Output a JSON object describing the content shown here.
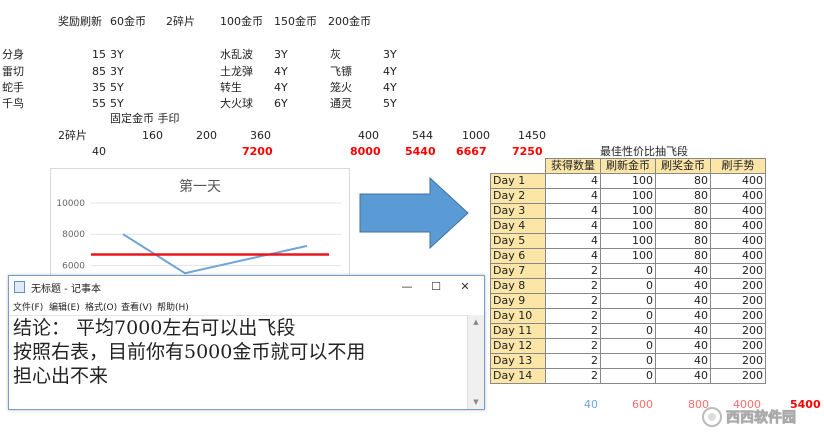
{
  "top": {
    "row1": [
      "奖励刷新",
      "60金币",
      "2碎片",
      "100金币",
      "150金币",
      "200金币"
    ],
    "items_col1": [
      {
        "name": "分身",
        "val": "15",
        "dur": "3Y"
      },
      {
        "name": "雷切",
        "val": "85",
        "dur": "3Y"
      },
      {
        "name": "蛇手",
        "val": "35",
        "dur": "5Y"
      },
      {
        "name": "千鸟",
        "val": "55",
        "dur": "5Y"
      }
    ],
    "items_col2": [
      {
        "name": "水乱波",
        "dur": "3Y"
      },
      {
        "name": "土龙弹",
        "dur": "4Y"
      },
      {
        "name": "转生",
        "dur": "4Y"
      },
      {
        "name": "大火球",
        "dur": "6Y"
      }
    ],
    "items_col3": [
      {
        "name": "灰",
        "dur": "3Y"
      },
      {
        "name": "飞镖",
        "dur": "4Y"
      },
      {
        "name": "笼火",
        "dur": "4Y"
      },
      {
        "name": "通灵",
        "dur": "5Y"
      }
    ],
    "fixed_label": "固定金币 手印",
    "row_costs": [
      "2碎片",
      "160",
      "200",
      "360",
      "400",
      "544",
      "1000",
      "1450"
    ],
    "row_totals": [
      "40",
      "7200",
      "8000",
      "5440",
      "6667",
      "7250"
    ]
  },
  "chart": {
    "title": "第一天",
    "yticks": [
      "10000",
      "8000",
      "6000"
    ]
  },
  "chart_data": {
    "type": "line",
    "title": "第一天",
    "ylim": [
      5000,
      10000
    ],
    "yticks": [
      6000,
      8000,
      10000
    ],
    "series": [
      {
        "values": [
          8000,
          5500,
          7250
        ],
        "color": "#6fa4d6"
      },
      {
        "values": [
          6700,
          6700,
          6700
        ],
        "color": "#e8171e"
      }
    ]
  },
  "notepad": {
    "title": "无标题 - 记事本",
    "menu": [
      "文件(F)",
      "编辑(E)",
      "格式(O)",
      "查看(V)",
      "帮助(H)"
    ],
    "lines": [
      "结论：  平均7000左右可以出飞段",
      "按照右表，目前你有5000金币就可以不用",
      "担心出不来"
    ],
    "minimize": "—",
    "maximize": "☐",
    "close": "✕"
  },
  "table": {
    "title": "最佳性价比抽飞段",
    "headers": [
      "",
      "获得数量",
      "刷新金币",
      "刷奖金币",
      "刷手势"
    ],
    "rows": [
      [
        "Day 1",
        "4",
        "100",
        "80",
        "400"
      ],
      [
        "Day 2",
        "4",
        "100",
        "80",
        "400"
      ],
      [
        "Day 3",
        "4",
        "100",
        "80",
        "400"
      ],
      [
        "Day 4",
        "4",
        "100",
        "80",
        "400"
      ],
      [
        "Day 5",
        "4",
        "100",
        "80",
        "400"
      ],
      [
        "Day 6",
        "4",
        "100",
        "80",
        "400"
      ],
      [
        "Day 7",
        "2",
        "0",
        "40",
        "200"
      ],
      [
        "Day 8",
        "2",
        "0",
        "40",
        "200"
      ],
      [
        "Day 9",
        "2",
        "0",
        "40",
        "200"
      ],
      [
        "Day 10",
        "2",
        "0",
        "40",
        "200"
      ],
      [
        "Day 11",
        "2",
        "0",
        "40",
        "200"
      ],
      [
        "Day 12",
        "2",
        "0",
        "40",
        "200"
      ],
      [
        "Day 13",
        "2",
        "0",
        "40",
        "200"
      ],
      [
        "Day 14",
        "2",
        "0",
        "40",
        "200"
      ]
    ],
    "totals": [
      "40",
      "600",
      "800",
      "4000",
      "5400"
    ]
  },
  "watermark": "西西软件园",
  "colors": {
    "red": "#ff0000",
    "header_fill": "#fbe6a8",
    "arrow": "#5b9bd5"
  }
}
